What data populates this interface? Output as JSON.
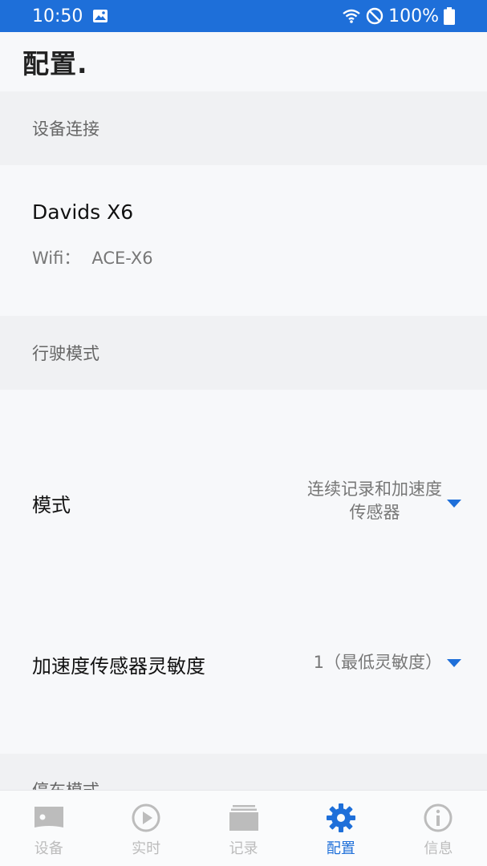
{
  "status_bar": {
    "time": "10:50",
    "battery": "100%"
  },
  "header": {
    "title": "配置."
  },
  "sections": {
    "device": {
      "title": "设备连接",
      "device_name": "Davids X6",
      "wifi_label": "Wifi：",
      "wifi_value": "ACE-X6"
    },
    "driving": {
      "title": "行驶模式",
      "mode_label": "模式",
      "mode_value": "连续记录和加速度\n传感器",
      "sensitivity_label": "加速度传感器灵敏度",
      "sensitivity_value": "1（最低灵敏度）"
    },
    "parking": {
      "title": "停车模式"
    }
  },
  "nav": {
    "items": [
      {
        "label": "设备",
        "icon": "device-icon"
      },
      {
        "label": "实时",
        "icon": "play-icon"
      },
      {
        "label": "记录",
        "icon": "folder-icon"
      },
      {
        "label": "配置",
        "icon": "gear-icon"
      },
      {
        "label": "信息",
        "icon": "info-icon"
      }
    ]
  },
  "colors": {
    "accent": "#1e6fd9",
    "inactive": "#bcbcbc"
  }
}
